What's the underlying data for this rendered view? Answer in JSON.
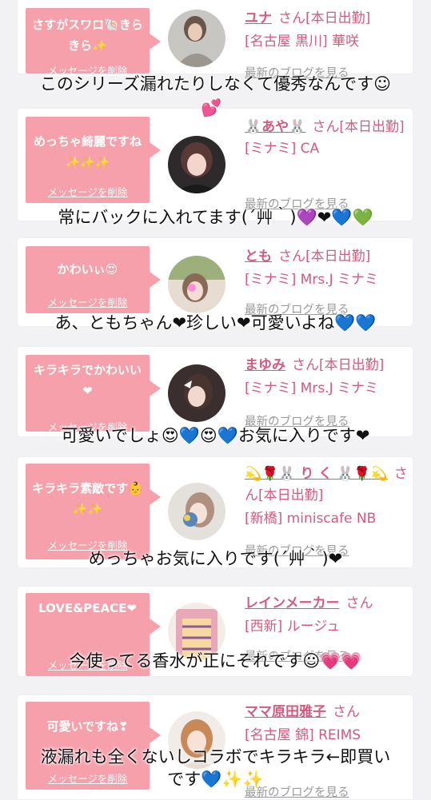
{
  "cards": [
    {
      "message": "さすがスワロ🐚きらきら✨",
      "delete_label": "メッセージを削除",
      "name": "ユナ",
      "san": "さん[本日出勤]",
      "shop": "[名古屋 黒川] 華咲",
      "blog_label": "最新のブログを見る",
      "avatar_icon": "photo-avatar"
    },
    {
      "message": "めっちゃ綺麗ですね✨✨✨",
      "delete_label": "メッセージを削除",
      "name": "🐰あや🐰",
      "san": "さん[本日出勤]",
      "shop": "[ミナミ] CA",
      "blog_label": "最新のブログを見る",
      "avatar_icon": "photo-avatar"
    },
    {
      "message": "かわいぃ😍",
      "delete_label": "メッセージを削除",
      "name": "とも",
      "san": "さん[本日出勤]",
      "shop": "[ミナミ] Mrs.J ミナミ",
      "blog_label": "最新のブログを見る",
      "avatar_icon": "photo-avatar"
    },
    {
      "message": "キラキラでかわいい❤",
      "delete_label": "メッセージを削除",
      "name": "まゆみ",
      "san": "さん[本日出勤]",
      "shop": "[ミナミ] Mrs.J ミナミ",
      "blog_label": "最新のブログを見る",
      "avatar_icon": "photo-avatar"
    },
    {
      "message": "キラキラ素敵です👶✨✨",
      "delete_label": "メッセージを削除",
      "name": "💫🌹🐰 り く 🐰🌹💫",
      "san": "さん[本日出勤]",
      "shop": "[新橋] miniscafe NB",
      "blog_label": "最新のブログを見る",
      "avatar_icon": "photo-avatar"
    },
    {
      "message": "LOVE&PEACE❤",
      "delete_label": "メッセージを削除",
      "name": "レインメーカー",
      "san": "さん",
      "shop": "[西新] ルージュ",
      "blog_label": "最新のブログを見る",
      "avatar_icon": "photo-avatar"
    },
    {
      "message": "可愛いですね❣",
      "delete_label": "メッセージを削除",
      "name": "ママ原田雅子",
      "san": "さん",
      "shop": "[名古屋 錦] REIMS",
      "blog_label": "最新のブログを見る",
      "avatar_icon": "photo-avatar"
    }
  ],
  "captions": {
    "c1": "このシリーズ漏れたりしなくて優秀なんです☺",
    "c1b": "💕",
    "c2": "常にバックに入れてます(´艸｀)💜❤💙💚",
    "c3": "あ、ともちゃん❤珍しい❤可愛いよね💙💙",
    "c4": "可愛いでしょ😍💙😍💙お気に入りです❤",
    "c5": "めっちゃお気に入りです(´艸｀)❤",
    "c6": "今使ってる香水が正にそれです☺💗💗",
    "c7a": "液漏れも全くないしコラボでキラキラ←即買い",
    "c7b": "です💙✨✨"
  }
}
